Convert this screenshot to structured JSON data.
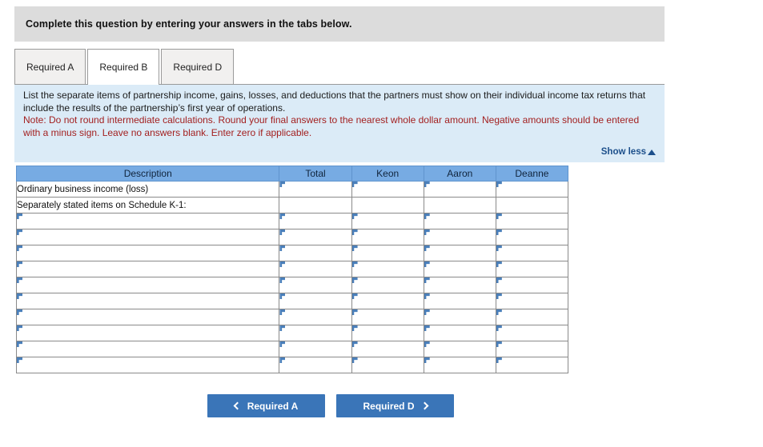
{
  "banner": {
    "title": "Complete this question by entering your answers in the tabs below."
  },
  "tabs": [
    {
      "label": "Required A",
      "active": false
    },
    {
      "label": "Required B",
      "active": true
    },
    {
      "label": "Required D",
      "active": false
    }
  ],
  "instructions": {
    "line1": "List the separate items of partnership income, gains, losses, and deductions that the partners must show on their individual income tax returns that include the results of the partnership’s first year of operations.",
    "note": "Note: Do not round intermediate calculations. Round your final answers to the nearest whole dollar amount. Negative amounts should be entered with a minus sign. Leave no answers blank. Enter zero if applicable.",
    "show_less_label": "Show less",
    "show_less_icon": "caret-up-icon"
  },
  "table": {
    "headers": [
      "Description",
      "Total",
      "Keon",
      "Aaron",
      "Deanne"
    ],
    "rows": [
      {
        "description": "Ordinary business income (loss)",
        "desc_input": false,
        "num_input": true,
        "values": [
          "",
          "",
          "",
          ""
        ]
      },
      {
        "description": "Separately stated items on Schedule K-1:",
        "desc_input": false,
        "num_input": false,
        "values": [
          "",
          "",
          "",
          ""
        ]
      },
      {
        "description": "",
        "desc_input": true,
        "num_input": true,
        "values": [
          "",
          "",
          "",
          ""
        ]
      },
      {
        "description": "",
        "desc_input": true,
        "num_input": true,
        "values": [
          "",
          "",
          "",
          ""
        ]
      },
      {
        "description": "",
        "desc_input": true,
        "num_input": true,
        "values": [
          "",
          "",
          "",
          ""
        ]
      },
      {
        "description": "",
        "desc_input": true,
        "num_input": true,
        "values": [
          "",
          "",
          "",
          ""
        ]
      },
      {
        "description": "",
        "desc_input": true,
        "num_input": true,
        "values": [
          "",
          "",
          "",
          ""
        ]
      },
      {
        "description": "",
        "desc_input": true,
        "num_input": true,
        "values": [
          "",
          "",
          "",
          ""
        ]
      },
      {
        "description": "",
        "desc_input": true,
        "num_input": true,
        "values": [
          "",
          "",
          "",
          ""
        ]
      },
      {
        "description": "",
        "desc_input": true,
        "num_input": true,
        "values": [
          "",
          "",
          "",
          ""
        ]
      },
      {
        "description": "",
        "desc_input": true,
        "num_input": true,
        "values": [
          "",
          "",
          "",
          ""
        ]
      },
      {
        "description": "",
        "desc_input": true,
        "num_input": true,
        "values": [
          "",
          "",
          "",
          ""
        ]
      }
    ]
  },
  "nav": {
    "prev_label": "Required A",
    "prev_icon": "chevron-left-icon",
    "next_label": "Required D",
    "next_icon": "chevron-right-icon"
  },
  "colors": {
    "banner_bg": "#dcdcdc",
    "panel_bg": "#dbebf7",
    "note_text": "#a32020",
    "table_header_bg": "#77abe3",
    "input_border": "#4a7fba",
    "button_bg": "#3a75b8",
    "link_text": "#1c4f8b"
  }
}
